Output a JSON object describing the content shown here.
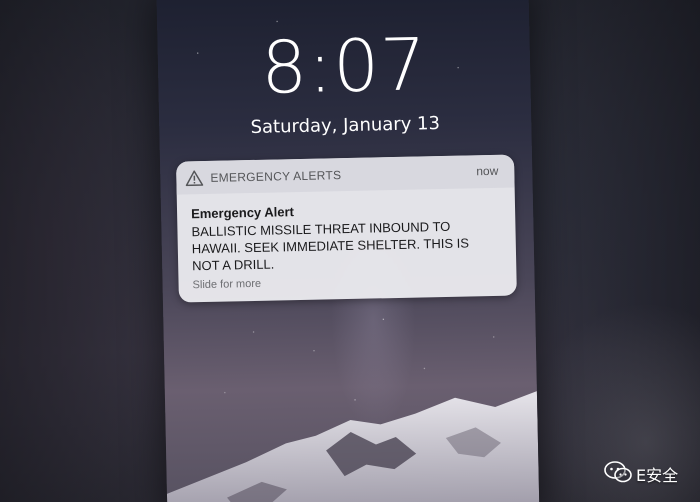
{
  "lockscreen": {
    "time": "8:07",
    "date": "Saturday, January 13"
  },
  "notification": {
    "icon": "warning-triangle-icon",
    "app_name": "EMERGENCY ALERTS",
    "timestamp": "now",
    "title": "Emergency Alert",
    "body": "BALLISTIC MISSILE THREAT INBOUND TO HAWAII. SEEK IMMEDIATE SHELTER. THIS IS NOT A DRILL.",
    "action_hint": "Slide for more"
  },
  "watermark": {
    "icon": "wechat-icon",
    "text": "E安全"
  },
  "colors": {
    "notification_bg": "#ececf0",
    "notification_header_bg": "#d7d7de",
    "text_primary": "#1a1a1c",
    "text_secondary": "#555659"
  }
}
